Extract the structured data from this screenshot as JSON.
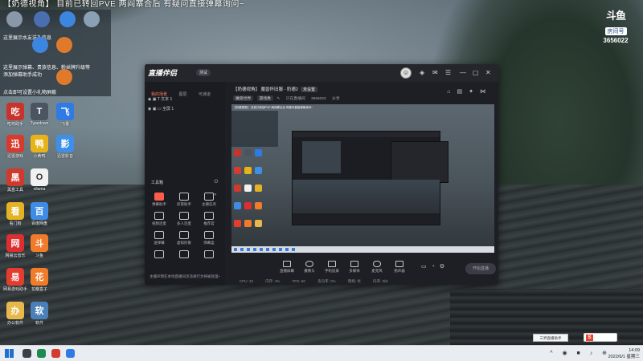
{
  "banner": {
    "text": "【奶德视角】 目前已转回PVE 两阎寨合后 有疑问直接弹幕询问~"
  },
  "room_badge": {
    "logo": "斗鱼",
    "label": "房间号",
    "number": "3656022"
  },
  "overlay": {
    "lines": [
      "这里展示水友送礼信息",
      "这里展示弹幕、贵族信息、粉丝牌升级等",
      "添加弹幕助手成功",
      "点击即可设置小礼物屏蔽"
    ],
    "top_labels": [
      "虚拟机",
      "7068",
      "我的电脑"
    ],
    "mid_labels": [
      "回收站",
      "服务器",
      "我的电脑"
    ]
  },
  "desktop_icons": [
    {
      "label": "吃鸡助手",
      "color": "#c8342c",
      "glyph": "吃"
    },
    {
      "label": "Typedown",
      "color": "#4b5561",
      "glyph": "T"
    },
    {
      "label": "飞書",
      "color": "#2f7ae5",
      "glyph": "飞"
    },
    {
      "label": "迅雷游戏",
      "color": "#d63b30",
      "glyph": "迅"
    },
    {
      "label": "小黄鸭",
      "color": "#e8b319",
      "glyph": "鸭"
    },
    {
      "label": "迅雷影音",
      "color": "#3e8fe8",
      "glyph": "影"
    },
    {
      "label": "黑盒工具",
      "color": "#cf3a2f",
      "glyph": "黑"
    },
    {
      "label": "ollama",
      "color": "#f1f1f1",
      "glyph": "O"
    },
    {
      "label": "看门狗",
      "color": "#e3b323",
      "glyph": "看"
    },
    {
      "label": "百度网盘",
      "color": "#3d8ce8",
      "glyph": "百"
    },
    {
      "label": "网易云音乐",
      "color": "#dd2f2f",
      "glyph": "网"
    },
    {
      "label": "斗鱼",
      "color": "#f07b2b",
      "glyph": "斗"
    },
    {
      "label": "网易游戏助手",
      "color": "#e23d2f",
      "glyph": "易"
    },
    {
      "label": "花瓣盒子",
      "color": "#f07c2a",
      "glyph": "花"
    },
    {
      "label": "办公软件",
      "color": "#e7b94b",
      "glyph": "办"
    },
    {
      "label": "软件",
      "color": "#4a7fb8",
      "glyph": "软"
    }
  ],
  "app": {
    "name": "直播伴侣",
    "version": "测试",
    "side_tabs": [
      "我的场景",
      "图层",
      "可通道"
    ],
    "scenes": [
      "文本 1",
      "全屏 1"
    ],
    "tools_title": "工具箱",
    "tools": [
      "弹幕助手",
      "房管助手",
      "主播任务",
      "视频连麦",
      "多人连麦",
      "推荐官",
      "送弹幕",
      "虚拟形象",
      "弹幕盒",
      "",
      "",
      ""
    ],
    "room_title": "【奶德视角】 魔兽怀旧服 - 奶德2",
    "room_tag": "未设置",
    "meta": [
      "魔兽世界",
      "游戏秀",
      "只在直播间",
      "3656022",
      "分享"
    ],
    "preview_banner": "【奶德视角】 目前已转回PVE 两阎寨合后 有疑问直接弹幕询问~",
    "bottom_tools": [
      "直播屏幕",
      "摄像头",
      "手机投屏",
      "多媒体",
      "麦克风",
      "扬声器"
    ],
    "live_button": "开始直播",
    "status": [
      "CPU: 32",
      "内存: 4%",
      "FPS: 60",
      "丢包率: 0%",
      "网络: 优",
      "码率: 0kb"
    ],
    "notice": "主播声明在本场直播间涉违规行为将被处理~"
  },
  "taskbar": {
    "tooltip": "三界直播助手",
    "time": "14:09",
    "date": "2022/6/1 星期三",
    "tray_icons": "^ ◉ ■ ♪ ⊕"
  }
}
